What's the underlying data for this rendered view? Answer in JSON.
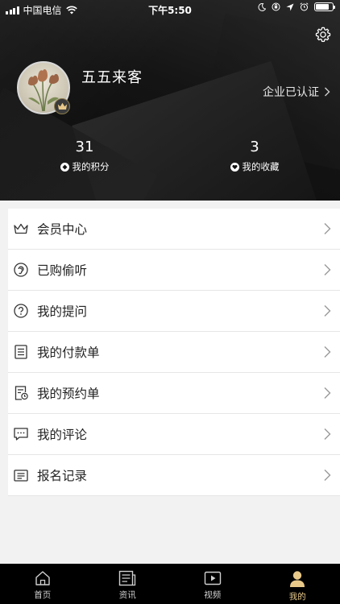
{
  "status_bar": {
    "carrier": "中国电信",
    "time": "下午5:50"
  },
  "profile": {
    "username": "五五来客",
    "verified_text": "企业已认证",
    "stats": [
      {
        "value": "31",
        "label": "我的积分"
      },
      {
        "value": "3",
        "label": "我的收藏"
      }
    ]
  },
  "menu": [
    {
      "label": "会员中心",
      "icon": "crown-icon"
    },
    {
      "label": "已购偷听",
      "icon": "ear-icon"
    },
    {
      "label": "我的提问",
      "icon": "question-icon"
    },
    {
      "label": "我的付款单",
      "icon": "document-icon"
    },
    {
      "label": "我的预约单",
      "icon": "appointment-icon"
    },
    {
      "label": "我的评论",
      "icon": "comment-icon"
    },
    {
      "label": "报名记录",
      "icon": "register-icon"
    }
  ],
  "tabs": [
    {
      "label": "首页",
      "icon": "home-icon"
    },
    {
      "label": "资讯",
      "icon": "news-icon"
    },
    {
      "label": "视频",
      "icon": "video-icon"
    },
    {
      "label": "我的",
      "icon": "user-icon",
      "active": true
    }
  ],
  "colors": {
    "active_tab": "#e8c98a",
    "header_bg": "#141414"
  }
}
